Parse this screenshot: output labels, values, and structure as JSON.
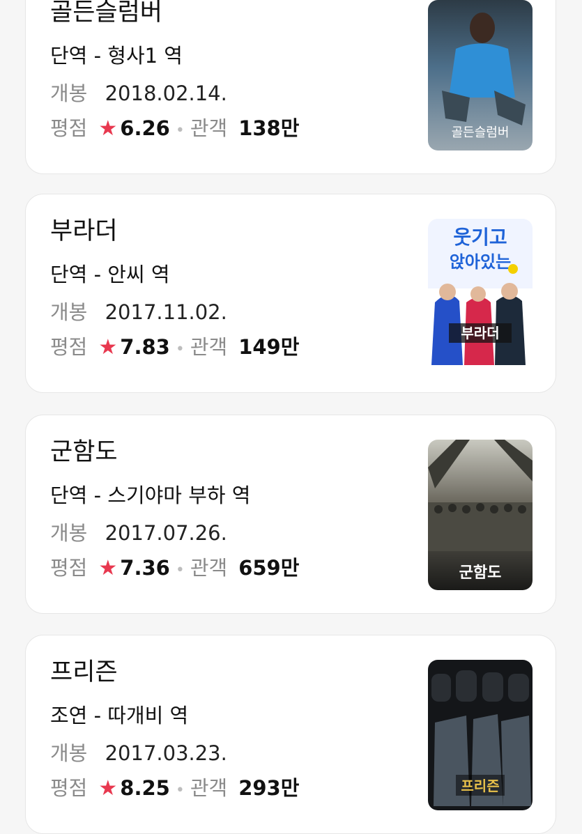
{
  "movies": [
    {
      "title": "골든슬럼버",
      "role": "단역 - 형사1 역",
      "release_label": "개봉",
      "release_date": "2018.02.14.",
      "rating_label": "평점",
      "rating": "6.26",
      "audience_label": "관객",
      "audience": "138만",
      "poster_text": "골든슬럼버"
    },
    {
      "title": "부라더",
      "role": "단역 - 안씨 역",
      "release_label": "개봉",
      "release_date": "2017.11.02.",
      "rating_label": "평점",
      "rating": "7.83",
      "audience_label": "관객",
      "audience": "149만",
      "poster_text": "부라더"
    },
    {
      "title": "군함도",
      "role": "단역 - 스기야마 부하 역",
      "release_label": "개봉",
      "release_date": "2017.07.26.",
      "rating_label": "평점",
      "rating": "7.36",
      "audience_label": "관객",
      "audience": "659만",
      "poster_text": "군함도"
    },
    {
      "title": "프리즌",
      "role": "조연 - 따개비 역",
      "release_label": "개봉",
      "release_date": "2017.03.23.",
      "rating_label": "평점",
      "rating": "8.25",
      "audience_label": "관객",
      "audience": "293만",
      "poster_text": "프리즌"
    }
  ],
  "icons": {
    "rating_star": "star-icon",
    "separator": "dot-separator"
  },
  "colors": {
    "star": "#e8384f",
    "label_gray": "#8a8a8a",
    "card_border": "#e6e6e6"
  }
}
